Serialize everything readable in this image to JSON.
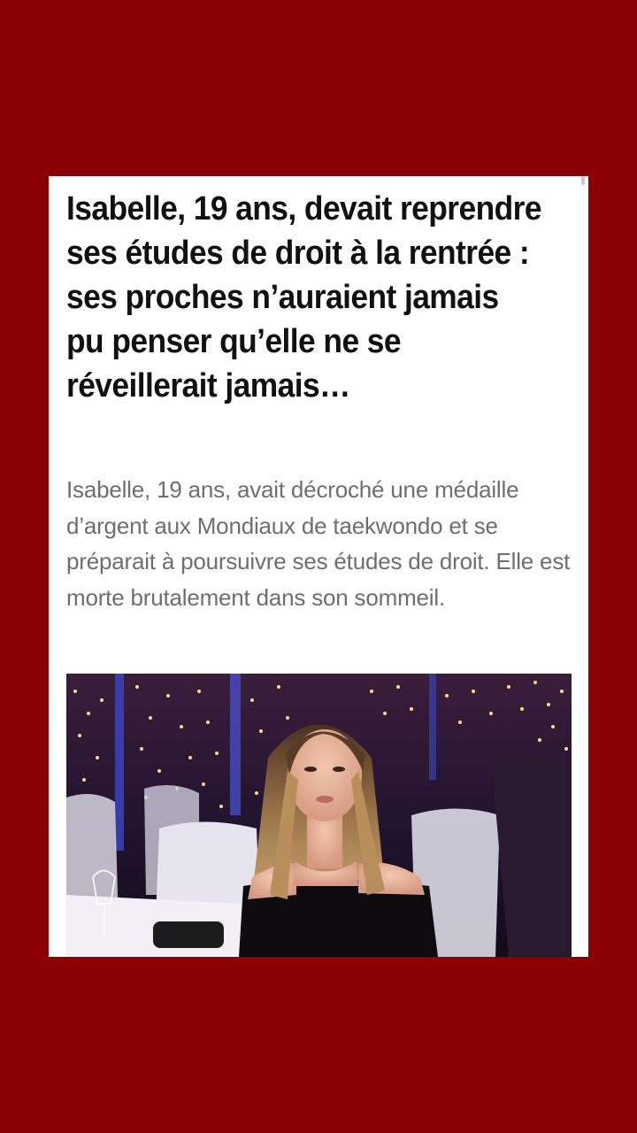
{
  "article": {
    "headline": "Isabelle, 19 ans, devait reprendre ses études de droit à la rentrée : ses proches n’auraient jamais pu penser qu’elle ne se réveillerait jamais…",
    "lead": "Isabelle, 19 ans, avait décroché une médaille d’argent aux Mondiaux de taekwondo et se préparait à poursuivre ses études de droit. Elle est morte brutalement dans son sommeil."
  },
  "colors": {
    "background": "#8b0000",
    "card": "#ffffff",
    "headline": "#111111",
    "lead": "#6e6e6e"
  }
}
